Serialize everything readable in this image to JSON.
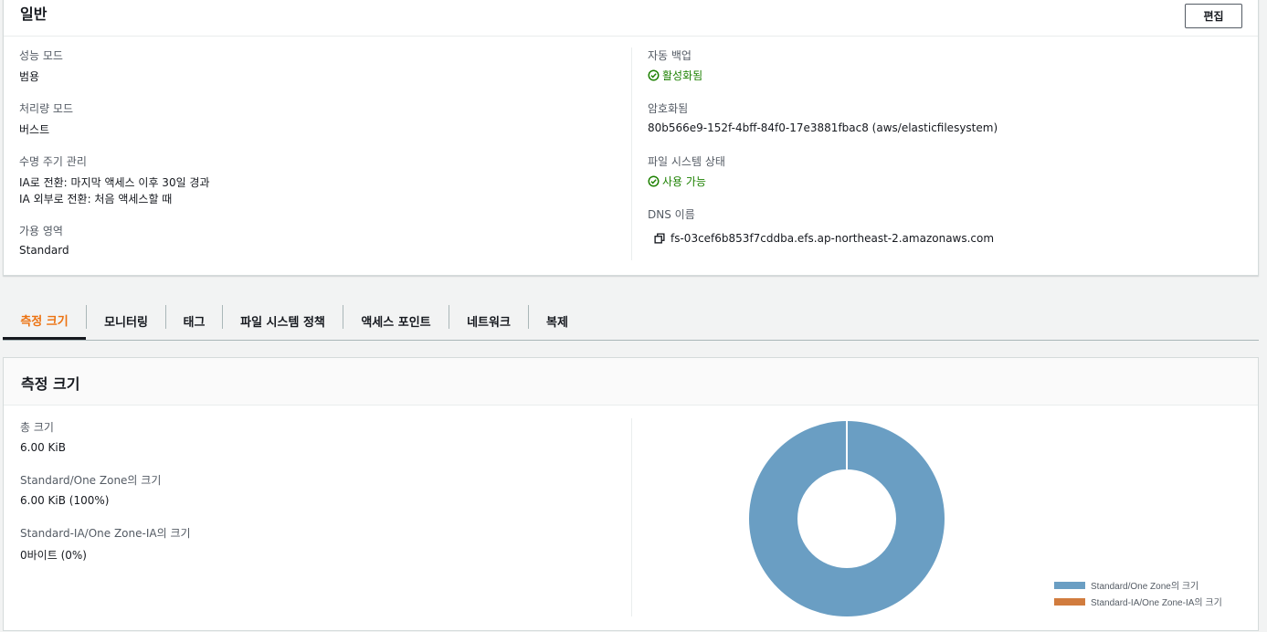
{
  "general": {
    "title": "일반",
    "edit_label": "편집",
    "performance_mode": {
      "label": "성능 모드",
      "value": "범용"
    },
    "throughput_mode": {
      "label": "처리량 모드",
      "value": "버스트"
    },
    "lifecycle": {
      "label": "수명 주기 관리",
      "value_line1": "IA로 전환: 마지막 액세스 이후 30일 경과",
      "value_line2": "IA 외부로 전환: 처음 액세스할 때"
    },
    "availability_zone": {
      "label": "가용 영역",
      "value": "Standard"
    },
    "auto_backup": {
      "label": "자동 백업",
      "value": "활성화됨"
    },
    "encrypted": {
      "label": "암호화됨",
      "value": "80b566e9-152f-4bff-84f0-17e3881fbac8 (aws/elasticfilesystem)"
    },
    "fs_state": {
      "label": "파일 시스템 상태",
      "value": "사용 가능"
    },
    "dns": {
      "label": "DNS 이름",
      "value": "fs-03cef6b853f7cddba.efs.ap-northeast-2.amazonaws.com"
    }
  },
  "tabs": [
    {
      "label": "측정 크기",
      "active": true
    },
    {
      "label": "모니터링"
    },
    {
      "label": "태그"
    },
    {
      "label": "파일 시스템 정책"
    },
    {
      "label": "액세스 포인트"
    },
    {
      "label": "네트워크"
    },
    {
      "label": "복제"
    }
  ],
  "metered": {
    "title": "측정 크기",
    "total": {
      "label": "총 크기",
      "value": "6.00 KiB"
    },
    "standard": {
      "label": "Standard/One Zone의 크기",
      "value": "6.00 KiB (100%)"
    },
    "ia": {
      "label": "Standard-IA/One Zone-IA의 크기",
      "value": "0바이트 (0%)"
    }
  },
  "chart_data": {
    "type": "pie",
    "donut": true,
    "categories": [
      "Standard/One Zone의 크기",
      "Standard-IA/One Zone-IA의 크기"
    ],
    "values": [
      100,
      0
    ],
    "colors": [
      "#6a9ec3",
      "#d17c3e"
    ],
    "legend": "bottom-right"
  },
  "colors": {
    "accent": "#ec7211",
    "success": "#1d8102",
    "standard": "#6a9ec3",
    "ia": "#d17c3e"
  }
}
